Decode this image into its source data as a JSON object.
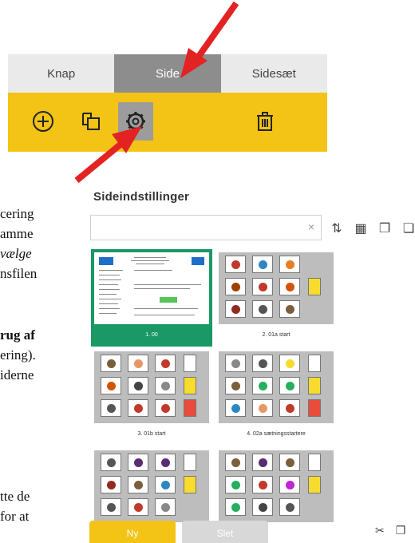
{
  "tabs": [
    {
      "label": "Knap",
      "active": false
    },
    {
      "label": "Side",
      "active": true
    },
    {
      "label": "Sidesæt",
      "active": false
    }
  ],
  "toolbar": {
    "icons": [
      "add-circle-icon",
      "copy-pages-icon",
      "gear-icon",
      "trash-icon"
    ],
    "selected": "gear-icon",
    "color": "#f3c315"
  },
  "doc_fragments": [
    {
      "text": "cering",
      "style": "normal"
    },
    {
      "text": "amme",
      "style": "normal"
    },
    {
      "text": "vælge",
      "style": "ital"
    },
    {
      "text": "nsfilen",
      "style": "normal"
    },
    {
      "text": "rug af",
      "style": "bold"
    },
    {
      "text": "ering).",
      "style": "normal"
    },
    {
      "text": "iderne",
      "style": "normal"
    },
    {
      "text": "tte de",
      "style": "normal"
    },
    {
      "text": "for at",
      "style": "normal"
    }
  ],
  "panel": {
    "title": "Sideindstillinger",
    "search_value": "",
    "clear_glyph": "×",
    "tool_icons": [
      "sort-az-icon",
      "grid-icon",
      "add-page-icon",
      "copy-icon"
    ]
  },
  "pages": [
    {
      "label": "1. 00",
      "selected": true
    },
    {
      "label": "2. 01a start",
      "selected": false
    },
    {
      "label": "3. 01b start",
      "selected": false
    },
    {
      "label": "4. 02a sætningsstartere",
      "selected": false
    },
    {
      "label": "",
      "selected": false
    },
    {
      "label": "",
      "selected": false
    }
  ],
  "buttons": {
    "new": "Ny",
    "delete": "Slet"
  },
  "colors": {
    "accent": "#f3c315",
    "selected": "#1a9966",
    "arrow": "#e32222"
  }
}
